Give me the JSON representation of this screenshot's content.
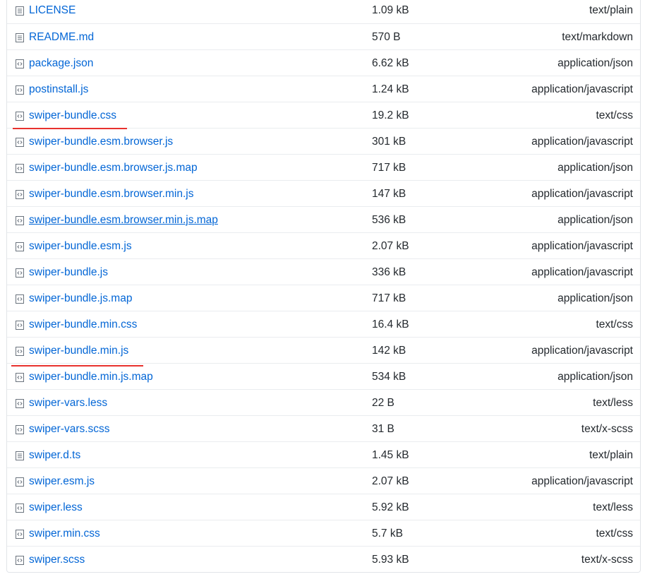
{
  "files": [
    {
      "name": "LICENSE",
      "size": "1.09 kB",
      "type": "text/plain",
      "icon": "file-text-icon"
    },
    {
      "name": "README.md",
      "size": "570 B",
      "type": "text/markdown",
      "icon": "file-text-icon"
    },
    {
      "name": "package.json",
      "size": "6.62 kB",
      "type": "application/json",
      "icon": "file-code-icon"
    },
    {
      "name": "postinstall.js",
      "size": "1.24 kB",
      "type": "application/javascript",
      "icon": "file-code-icon"
    },
    {
      "name": "swiper-bundle.css",
      "size": "19.2 kB",
      "type": "text/css",
      "icon": "file-code-icon"
    },
    {
      "name": "swiper-bundle.esm.browser.js",
      "size": "301 kB",
      "type": "application/javascript",
      "icon": "file-code-icon"
    },
    {
      "name": "swiper-bundle.esm.browser.js.map",
      "size": "717 kB",
      "type": "application/json",
      "icon": "file-code-icon"
    },
    {
      "name": "swiper-bundle.esm.browser.min.js",
      "size": "147 kB",
      "type": "application/javascript",
      "icon": "file-code-icon"
    },
    {
      "name": "swiper-bundle.esm.browser.min.js.map",
      "size": "536 kB",
      "type": "application/json",
      "icon": "file-code-icon"
    },
    {
      "name": "swiper-bundle.esm.js",
      "size": "2.07 kB",
      "type": "application/javascript",
      "icon": "file-code-icon"
    },
    {
      "name": "swiper-bundle.js",
      "size": "336 kB",
      "type": "application/javascript",
      "icon": "file-code-icon"
    },
    {
      "name": "swiper-bundle.js.map",
      "size": "717 kB",
      "type": "application/json",
      "icon": "file-code-icon"
    },
    {
      "name": "swiper-bundle.min.css",
      "size": "16.4 kB",
      "type": "text/css",
      "icon": "file-code-icon"
    },
    {
      "name": "swiper-bundle.min.js",
      "size": "142 kB",
      "type": "application/javascript",
      "icon": "file-code-icon"
    },
    {
      "name": "swiper-bundle.min.js.map",
      "size": "534 kB",
      "type": "application/json",
      "icon": "file-code-icon"
    },
    {
      "name": "swiper-vars.less",
      "size": "22 B",
      "type": "text/less",
      "icon": "file-code-icon"
    },
    {
      "name": "swiper-vars.scss",
      "size": "31 B",
      "type": "text/x-scss",
      "icon": "file-code-icon"
    },
    {
      "name": "swiper.d.ts",
      "size": "1.45 kB",
      "type": "text/plain",
      "icon": "file-text-icon"
    },
    {
      "name": "swiper.esm.js",
      "size": "2.07 kB",
      "type": "application/javascript",
      "icon": "file-code-icon"
    },
    {
      "name": "swiper.less",
      "size": "5.92 kB",
      "type": "text/less",
      "icon": "file-code-icon"
    },
    {
      "name": "swiper.min.css",
      "size": "5.7 kB",
      "type": "text/css",
      "icon": "file-code-icon"
    },
    {
      "name": "swiper.scss",
      "size": "5.93 kB",
      "type": "text/x-scss",
      "icon": "file-code-icon"
    }
  ],
  "colors": {
    "link": "#0366d6",
    "text": "#24292e",
    "icon": "#6a737d",
    "border": "#eaecef",
    "highlight_underline": "#e8322e"
  }
}
